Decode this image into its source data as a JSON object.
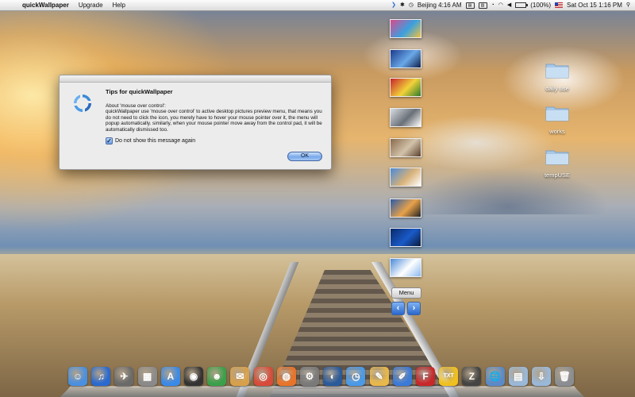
{
  "menubar": {
    "app_name": "quickWallpaper",
    "menus": [
      "Upgrade",
      "Help"
    ],
    "status": {
      "location_time": "Beijing 4:16 AM",
      "battery": "(100%)",
      "datetime": "Sat Oct 15  1:16 PM"
    }
  },
  "dialog": {
    "title": "Tips for quickWallpaper",
    "heading": "About 'mouse over control':",
    "body": "quickWallpaper use 'mouse over control' to active desktop pictures preview menu, that means you do not need to click the icon, you merely have to hover your mouse pointer over it, the menu will popup automatically. similarly, when your mouse pointer move away from the control pad, it will be automatically dismissed too.",
    "checkbox_label": "Do not show this message again",
    "checkbox_checked": true,
    "ok_label": "OK"
  },
  "thumbnails": [
    {
      "name": "colored-pencils",
      "colors": [
        "#d94a8c",
        "#3aa0e0",
        "#f2c23a"
      ]
    },
    {
      "name": "windows-screen",
      "colors": [
        "#1b3a8a",
        "#6aa8e8",
        "#0c1e4a"
      ]
    },
    {
      "name": "billiard-balls",
      "colors": [
        "#c8242a",
        "#f2d23a",
        "#2a7a2a"
      ]
    },
    {
      "name": "statue-liberty",
      "colors": [
        "#d8dde2",
        "#6a7078",
        "#ffffff"
      ]
    },
    {
      "name": "wooden-planks",
      "colors": [
        "#8a6a4a",
        "#d2c2aa",
        "#5a3e2a"
      ]
    },
    {
      "name": "pyramids",
      "colors": [
        "#4a8ad8",
        "#d8b27a",
        "#ffffff"
      ]
    },
    {
      "name": "highway-sky",
      "colors": [
        "#2a5aa8",
        "#e8a24a",
        "#222222"
      ]
    },
    {
      "name": "blue-abstract",
      "colors": [
        "#0a2a6a",
        "#1a5ac8",
        "#0a1a3a"
      ]
    },
    {
      "name": "airplane-sky",
      "colors": [
        "#4a8ad8",
        "#ffffff",
        "#8ab8f0"
      ]
    }
  ],
  "controls": {
    "menu_label": "Menu",
    "prev_glyph": "🡄",
    "next_glyph": "🡆"
  },
  "folders": [
    {
      "label": "daily use"
    },
    {
      "label": "works"
    },
    {
      "label": "tempUSE"
    }
  ],
  "dock": [
    {
      "name": "finder",
      "color": "#4a90e0",
      "glyph": "☺"
    },
    {
      "name": "itunes",
      "color": "#2a6ad0",
      "glyph": "♫"
    },
    {
      "name": "launchpad",
      "color": "#6a6a6a",
      "glyph": "✈"
    },
    {
      "name": "preview",
      "color": "#8a8a8a",
      "glyph": "▦"
    },
    {
      "name": "app-store",
      "color": "#3a8ae8",
      "glyph": "A"
    },
    {
      "name": "dashboard",
      "color": "#333333",
      "glyph": "◉"
    },
    {
      "name": "messenger",
      "color": "#3aa04a",
      "glyph": "☻"
    },
    {
      "name": "mail-stamp",
      "color": "#d8a04a",
      "glyph": "✉"
    },
    {
      "name": "chrome",
      "color": "#d84a3a",
      "glyph": "◎"
    },
    {
      "name": "firefox",
      "color": "#e8742a",
      "glyph": "◍"
    },
    {
      "name": "system-preferences",
      "color": "#7a7a7a",
      "glyph": "⚙"
    },
    {
      "name": "google-earth",
      "color": "#2a5a9a",
      "glyph": "◐"
    },
    {
      "name": "safari",
      "color": "#4a9ae8",
      "glyph": "◷"
    },
    {
      "name": "xcode-pencil",
      "color": "#e8b84a",
      "glyph": "✎"
    },
    {
      "name": "pages",
      "color": "#3a7ad8",
      "glyph": "✐"
    },
    {
      "name": "font-book",
      "color": "#c8282a",
      "glyph": "F"
    },
    {
      "name": "txt-editor",
      "color": "#f0c020",
      "glyph": "TXT"
    },
    {
      "name": "zip-utility",
      "color": "#444444",
      "glyph": "Z"
    },
    {
      "name": "network-globe",
      "color": "#5a8ac8",
      "glyph": "🌐"
    },
    {
      "name": "applications-folder",
      "color": "#9ab8d8",
      "glyph": "▤"
    },
    {
      "name": "downloads-folder",
      "color": "#9ab8d8",
      "glyph": "⇩"
    },
    {
      "name": "trash",
      "color": "#8a8e92",
      "glyph": "🗑"
    }
  ]
}
